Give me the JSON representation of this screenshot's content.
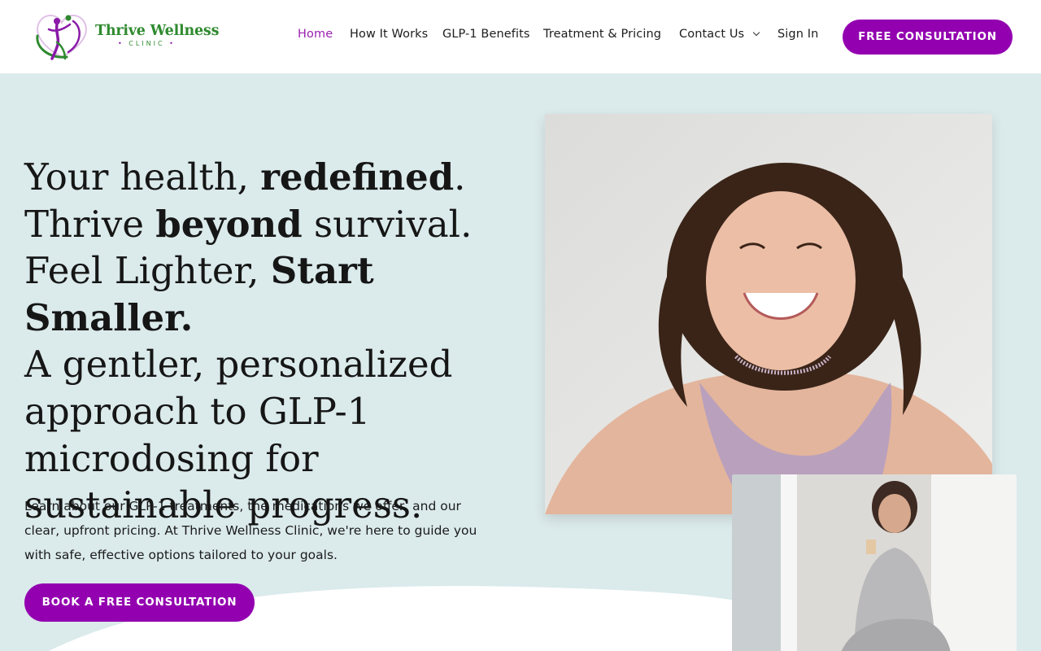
{
  "logo": {
    "title": "Thrive Wellness",
    "subtitle": "CLINIC",
    "colors": {
      "green": "#2f8a2f",
      "purple": "#8a1aa8"
    }
  },
  "nav": {
    "items": [
      {
        "label": "Home",
        "active": true
      },
      {
        "label": "How It Works",
        "active": false
      },
      {
        "label": "GLP-1 Benefits",
        "active": false
      },
      {
        "label": "Treatment & Pricing",
        "active": false
      },
      {
        "label": "Contact Us",
        "active": false,
        "dropdown": true
      },
      {
        "label": "Sign In",
        "active": false
      }
    ],
    "cta": "FREE CONSULTATION"
  },
  "hero": {
    "line1_a": "Your health, ",
    "line1_b": "redefined",
    "line1_c": ".",
    "line2_a": "Thrive ",
    "line2_b": "beyond",
    "line2_c": " survival.",
    "line3_a": "Feel Lighter, ",
    "line3_b": "Start Smaller.",
    "line4": "A gentler, personalized approach to GLP-1 microdosing for sustainable progress.",
    "paragraph": "Learn about our GLP-1 treatments, the medications we offer, and our clear, upfront pricing. At Thrive Wellness Clinic, we're here to guide you with safe, effective options tailored to your goals.",
    "cta": "BOOK A FREE CONSULTATION"
  },
  "theme": {
    "accent": "#9300b0",
    "active_nav": "#9b1fb0",
    "hero_bg": "#dbeaeb"
  }
}
